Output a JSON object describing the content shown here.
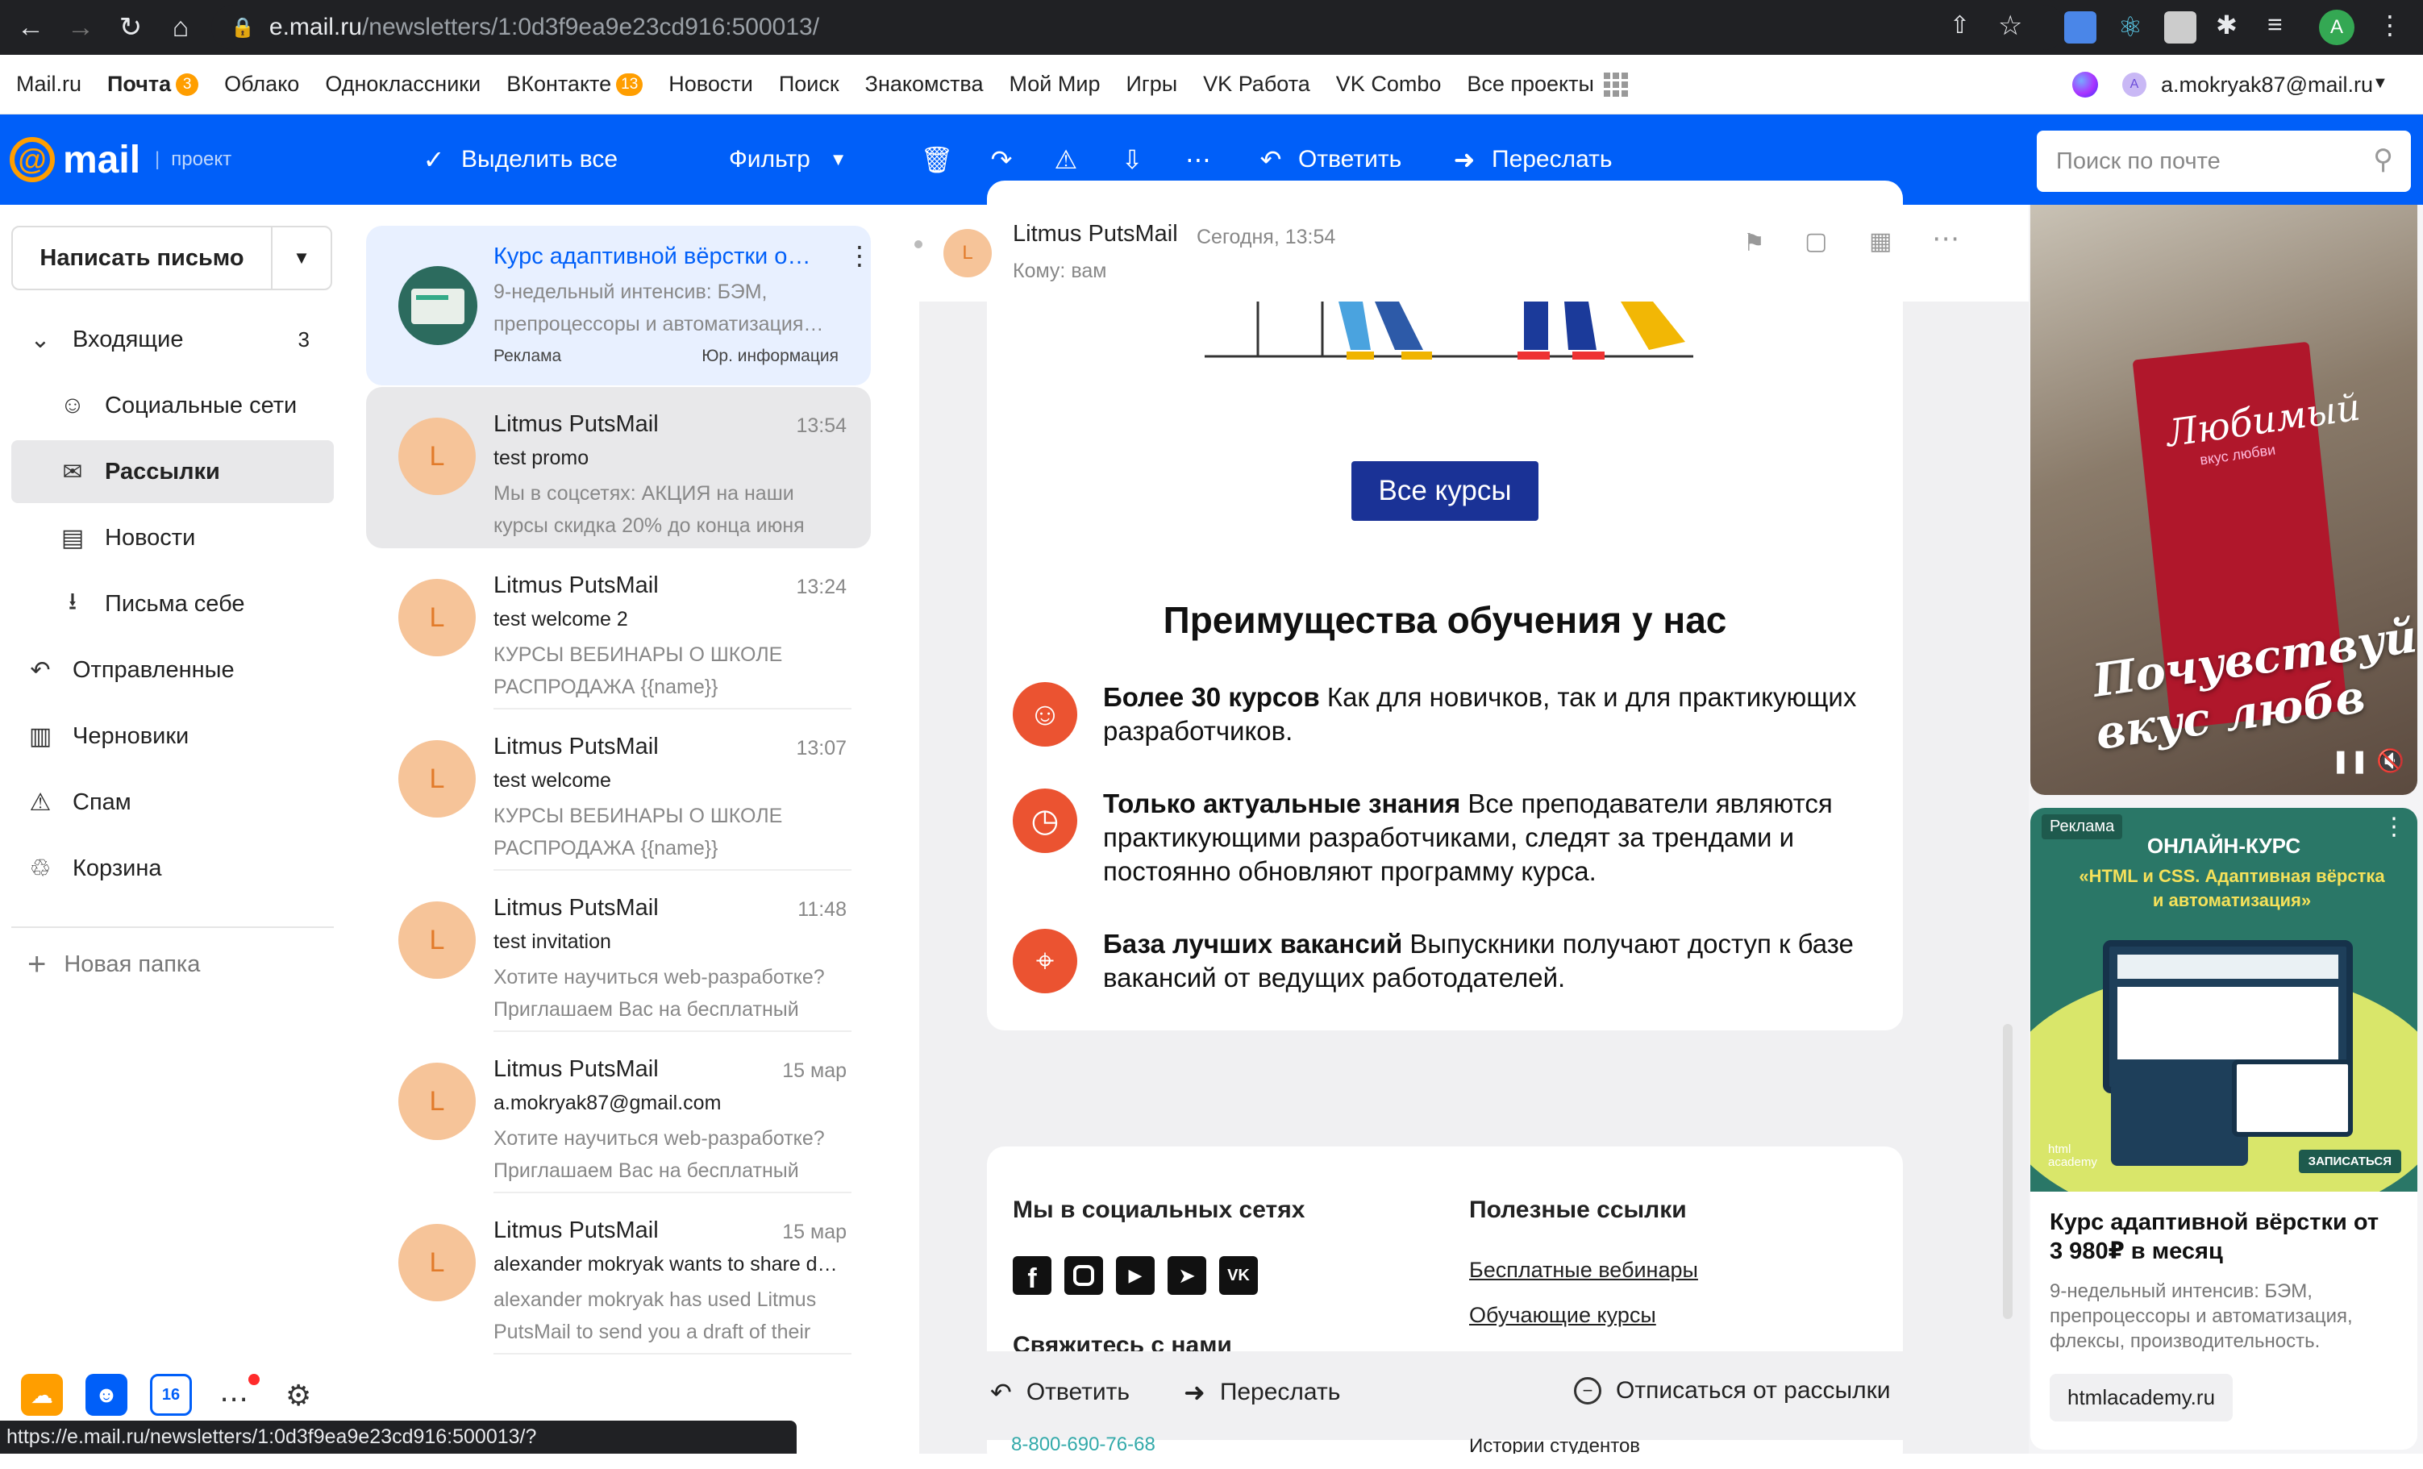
{
  "browser": {
    "url_host": "e.mail.ru",
    "url_path": "/newsletters/1:0d3f9ea9e23cd916:500013/",
    "status_url": "https://e.mail.ru/newsletters/1:0d3f9ea9e23cd916:500013/?",
    "profile_initial": "A"
  },
  "portal": {
    "items": [
      {
        "label": "Mail.ru"
      },
      {
        "label": "Почта",
        "badge": "3",
        "bold": true
      },
      {
        "label": "Облако"
      },
      {
        "label": "Одноклассники"
      },
      {
        "label": "ВКонтакте",
        "badge": "13"
      },
      {
        "label": "Новости"
      },
      {
        "label": "Поиск"
      },
      {
        "label": "Знакомства"
      },
      {
        "label": "Мой Мир"
      },
      {
        "label": "Игры"
      },
      {
        "label": "VK Работа"
      },
      {
        "label": "VK Combo"
      },
      {
        "label": "Все проекты"
      }
    ],
    "account": "a.mokryak87@mail.ru",
    "account_initial": "A"
  },
  "toolbar": {
    "logo": "mail",
    "project": "проект",
    "select_all": "Выделить все",
    "filter": "Фильтр",
    "reply": "Ответить",
    "forward": "Переслать",
    "search_placeholder": "Поиск по почте"
  },
  "sidebar": {
    "compose": "Написать письмо",
    "folders": [
      {
        "label": "Входящие",
        "count": "3",
        "icon": "chevron-down-icon"
      },
      {
        "label": "Социальные сети",
        "icon": "people-icon"
      },
      {
        "label": "Рассылки",
        "icon": "newsletter-icon",
        "active": true
      },
      {
        "label": "Новости",
        "icon": "news-icon"
      },
      {
        "label": "Письма себе",
        "icon": "inbox-self-icon"
      },
      {
        "label": "Отправленные",
        "icon": "sent-icon"
      },
      {
        "label": "Черновики",
        "icon": "draft-icon"
      },
      {
        "label": "Спам",
        "icon": "spam-icon"
      },
      {
        "label": "Корзина",
        "icon": "trash-icon"
      }
    ],
    "new_folder": "Новая папка"
  },
  "ad_message": {
    "title": "Курс адаптивной вёрстки о…",
    "preview": "9-недельный интенсив: БЭМ, препроцессоры и автоматизация…",
    "label": "Реклама",
    "legal": "Юр. информация"
  },
  "messages": [
    {
      "sender": "Litmus PutsMail",
      "time": "13:54",
      "subject": "test promo",
      "preview": "Мы в соцсетях: АКЦИЯ на наши курсы скидка 20% до конца июня",
      "initial": "L",
      "selected": true
    },
    {
      "sender": "Litmus PutsMail",
      "time": "13:24",
      "subject": "test welcome 2",
      "preview": "КУРСЫ ВЕБИНАРЫ О ШКОЛЕ РАСПРОДАЖА {{name}}",
      "initial": "L"
    },
    {
      "sender": "Litmus PutsMail",
      "time": "13:07",
      "subject": "test welcome",
      "preview": "КУРСЫ ВЕБИНАРЫ О ШКОЛЕ РАСПРОДАЖА {{name}}",
      "initial": "L"
    },
    {
      "sender": "Litmus PutsMail",
      "time": "11:48",
      "subject": "test invitation",
      "preview": "Хотите научиться web-разработке? Приглашаем Вас на бесплатный",
      "initial": "L"
    },
    {
      "sender": "Litmus PutsMail",
      "time": "15 мар",
      "subject": "a.mokryak87@gmail.com",
      "preview": "Хотите научиться web-разработке? Приглашаем Вас на бесплатный",
      "initial": "L"
    },
    {
      "sender": "Litmus PutsMail",
      "time": "15 мар",
      "subject": "alexander mokryak wants to share d…",
      "preview": "alexander mokryak has used Litmus PutsMail to send you a draft of their",
      "initial": "L"
    }
  ],
  "reader": {
    "sender": "Litmus PutsMail",
    "date": "Сегодня, 13:54",
    "to_label": "Кому:",
    "to_value": "вам",
    "initial": "L",
    "all_courses": "Все курсы",
    "adv_heading": "Преимущества обучения у нас",
    "advantages": [
      {
        "title": "Более 30 курсов",
        "text": "Как для новичков, так и для практикующих разработчиков.",
        "icon": "smile-icon"
      },
      {
        "title": "Только актуальные знания",
        "text": "Все преподаватели являются практикующими разработчиками, следят за трендами и постоянно обновляют программу курса.",
        "icon": "clock-icon"
      },
      {
        "title": "База лучших вакансий",
        "text": "Выпускники получают доступ к базе вакансий от ведущих работодателей.",
        "icon": "target-icon"
      }
    ],
    "social_heading": "Мы в социальных сетях",
    "links_heading": "Полезные ссылки",
    "links": [
      "Бесплатные вебинары",
      "Обучающие курсы"
    ],
    "contact_heading": "Свяжитесь с нами",
    "phone": "8-800-690-76-68",
    "stories": "Истории студентов",
    "bottom_reply": "Ответить",
    "bottom_forward": "Переслать",
    "unsubscribe": "Отписаться от рассылки"
  },
  "ads": {
    "video_text_1": "Любимый",
    "video_text_2": "вкус любви",
    "video_slogan_1": "Почувствуй",
    "video_slogan_2": "вкус любв",
    "banner_label": "Реклама",
    "banner_title": "ОНЛАЙН-КУРС",
    "banner_sub": "«HTML и CSS. Адаптивная вёрстка и автоматизация»",
    "banner_brand": "html academy",
    "banner_cta": "ЗАПИСАТЬСЯ",
    "ad_title": "Курс адаптивной вёрстки от 3 980₽ в месяц",
    "ad_desc": "9-недельный интенсив: БЭМ, препроцессоры и автоматизация, флексы, производительность.",
    "ad_domain": "htmlacademy.ru"
  },
  "dock": {
    "calendar_day": "16"
  },
  "colors": {
    "brand_blue": "#005ff9",
    "accent_orange": "#eb5331",
    "avatar_bg": "#f6c499",
    "button_navy": "#1a3296"
  }
}
